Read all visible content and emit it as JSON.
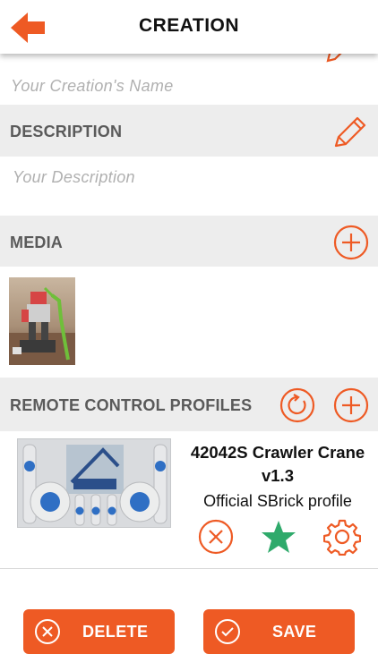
{
  "header": {
    "title": "CREATION",
    "back_icon": "arrow-left-icon"
  },
  "name_field": {
    "placeholder": "Your Creation's Name"
  },
  "description": {
    "section_title": "DESCRIPTION",
    "placeholder": "Your Description",
    "edit_icon": "pencil-icon"
  },
  "media": {
    "section_title": "MEDIA",
    "add_icon": "plus-circle-icon"
  },
  "profiles": {
    "section_title": "REMOTE CONTROL PROFILES",
    "refresh_icon": "refresh-circle-icon",
    "add_icon": "plus-circle-icon",
    "items": [
      {
        "name_line1": "42042S Crawler Crane",
        "name_line2": "v1.3",
        "subtitle": "Official SBrick profile",
        "remove_icon": "close-circle-icon",
        "favorite_icon": "star-icon",
        "settings_icon": "gear-icon"
      }
    ]
  },
  "buttons": {
    "delete_label": "DELETE",
    "save_label": "SAVE"
  },
  "colors": {
    "accent": "#ee5a24",
    "favorite": "#2faa6b",
    "section_bg": "#ededed",
    "placeholder": "#b0b0b0"
  }
}
